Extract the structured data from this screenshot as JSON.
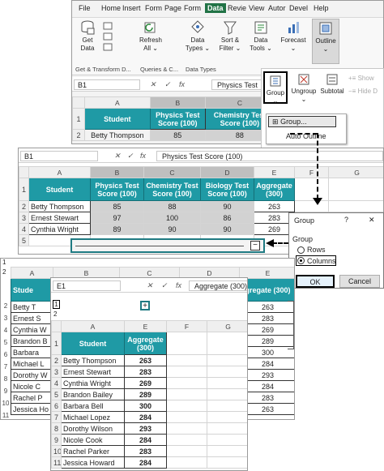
{
  "ribbon": {
    "tabs": [
      "File",
      "Home",
      "Insert",
      "Form",
      "Page",
      "Form",
      "Data",
      "Revie",
      "View",
      "Autor",
      "Devel",
      "Help"
    ],
    "active_tab": "Data",
    "get_data": "Get Data",
    "refresh_all_1": "Refresh",
    "refresh_all_2": "All",
    "data_types_1": "Data",
    "data_types_2": "Types",
    "sort_filter_1": "Sort &",
    "sort_filter_2": "Filter",
    "data_tools_1": "Data",
    "data_tools_2": "Tools",
    "forecast": "Forecast",
    "outline": "Outline",
    "group_get_transform": "Get & Transform D...",
    "group_queries": "Queries & C...",
    "group_data_types": "Data Types"
  },
  "outline_menu": {
    "group": "Group",
    "ungroup": "Ungroup",
    "subtotal": "Subtotal",
    "show_detail": "Show",
    "hide_detail": "Hide D",
    "dropdown_group": "Group...",
    "dropdown_auto": "Auto Outline"
  },
  "sheet1": {
    "namebox": "B1",
    "formula": "Physics Test",
    "cols": [
      "A",
      "B",
      "C"
    ],
    "header_student": "Student",
    "header_physics": "Physics Test Score (100)",
    "header_chem": "Chemistry Test Score (100)",
    "row2": [
      "Betty Thompson",
      "85",
      "88"
    ]
  },
  "sheet2": {
    "namebox": "B1",
    "formula": "Physics Test Score (100)",
    "cols": [
      "A",
      "B",
      "C",
      "D",
      "E",
      "F",
      "G"
    ],
    "headers": [
      "Student",
      "Physics Test Score (100)",
      "Chemistry Test Score (100)",
      "Biology Test Score (100)",
      "Aggregate (300)"
    ],
    "rows": [
      [
        "Betty Thompson",
        "85",
        "88",
        "90",
        "263"
      ],
      [
        "Ernest Stewart",
        "97",
        "100",
        "86",
        "283"
      ],
      [
        "Cynthia Wright",
        "89",
        "90",
        "90",
        "269"
      ]
    ],
    "collapse_btn": "−"
  },
  "dialog": {
    "title": "Group",
    "help": "?",
    "close": "✕",
    "section": "Group",
    "rows": "Rows",
    "columns": "Columns",
    "ok": "OK",
    "cancel": "Cancel"
  },
  "sheet3": {
    "namebox": "E1",
    "formula": "Aggregate (300)",
    "cols": [
      "A",
      "B",
      "C",
      "D",
      "E"
    ],
    "partial_names": [
      "Betty T",
      "Ernest S",
      "Cynthia W",
      "Brandon B",
      "Barbara",
      "Michael L",
      "Dorothy W",
      "Nicole C",
      "Rachel P",
      "Jessica Ho"
    ],
    "partial_header": "Stude",
    "partial_agg_header": "gregate (300)",
    "partial_agg": [
      "263",
      "283",
      "269",
      "289",
      "300",
      "284",
      "293",
      "284",
      "283",
      "263"
    ]
  },
  "sheet4": {
    "cols": [
      "A",
      "E",
      "F",
      "G"
    ],
    "level1": "1",
    "level2": "2",
    "expand_btn": "+",
    "header_student": "Student",
    "header_agg": "Aggregate (300)",
    "rows": [
      [
        "Betty Thompson",
        "263"
      ],
      [
        "Ernest Stewart",
        "283"
      ],
      [
        "Cynthia Wright",
        "269"
      ],
      [
        "Brandon Bailey",
        "289"
      ],
      [
        "Barbara Bell",
        "300"
      ],
      [
        "Michael Lopez",
        "284"
      ],
      [
        "Dorothy Wilson",
        "293"
      ],
      [
        "Nicole Cook",
        "284"
      ],
      [
        "Rachel Parker",
        "283"
      ],
      [
        "Jessica Howard",
        "284"
      ]
    ]
  }
}
